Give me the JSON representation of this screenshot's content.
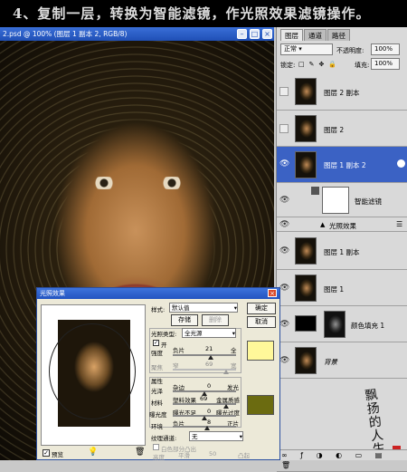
{
  "caption": "4、复制一层，转换为智能滤镜，作光照效果滤镜操作。",
  "document": {
    "title": "2.psd @ 100% (图层 1 副本 2, RGB/8)"
  },
  "layers_panel": {
    "tabs": [
      "图层",
      "通道",
      "路径"
    ],
    "blend_mode": "正常",
    "opacity_label": "不透明度:",
    "opacity_value": "100%",
    "lock_label": "锁定:",
    "fill_label": "填充:",
    "fill_value": "100%",
    "layers": [
      {
        "name": "图层 2 副本",
        "visible": false
      },
      {
        "name": "图层 2",
        "visible": false
      },
      {
        "name": "图层 1 副本 2",
        "visible": true,
        "selected": true
      },
      {
        "name": "智能滤镜",
        "visible": true
      },
      {
        "name": "光照效果",
        "visible": true
      },
      {
        "name": "图层 1 副本",
        "visible": true
      },
      {
        "name": "图层 1",
        "visible": true
      },
      {
        "name": "颜色填充 1",
        "visible": true
      },
      {
        "name": "背景",
        "visible": true
      }
    ]
  },
  "dialog": {
    "title": "光照效果",
    "style_label": "样式:",
    "style_value": "默认值",
    "save_label": "存储",
    "delete_label": "删除",
    "ok_label": "确定",
    "cancel_label": "取消",
    "light_type_label": "光照类型:",
    "light_type_value": "全光源",
    "on_label": "开",
    "intensity_label": "强度",
    "intensity_left": "负片",
    "intensity_value": "21",
    "intensity_right": "全",
    "focus_label": "聚焦",
    "focus_left": "窄",
    "focus_value": "69",
    "focus_right": "宽",
    "properties_label": "属性",
    "gloss_label": "光泽",
    "gloss_left": "杂边",
    "gloss_value": "0",
    "gloss_right": "发光",
    "material_label": "材料",
    "material_left": "塑料效果",
    "material_value": "69",
    "material_right": "金属质感",
    "exposure_label": "曝光度",
    "exposure_left": "曝光不足",
    "exposure_value": "0",
    "exposure_right": "曝光过度",
    "ambience_label": "环境",
    "ambience_left": "负片",
    "ambience_value": "8",
    "ambience_right": "正片",
    "texture_label": "纹理通道:",
    "texture_value": "无",
    "white_high_label": "白色部分凸出",
    "height_label": "高度",
    "height_left": "平滑",
    "height_value": "50",
    "height_right": "凸起",
    "preview_label": "预览",
    "light_color": "#fff89a",
    "ambience_color": "#6b6b10"
  },
  "watermark": "飘扬的人生"
}
